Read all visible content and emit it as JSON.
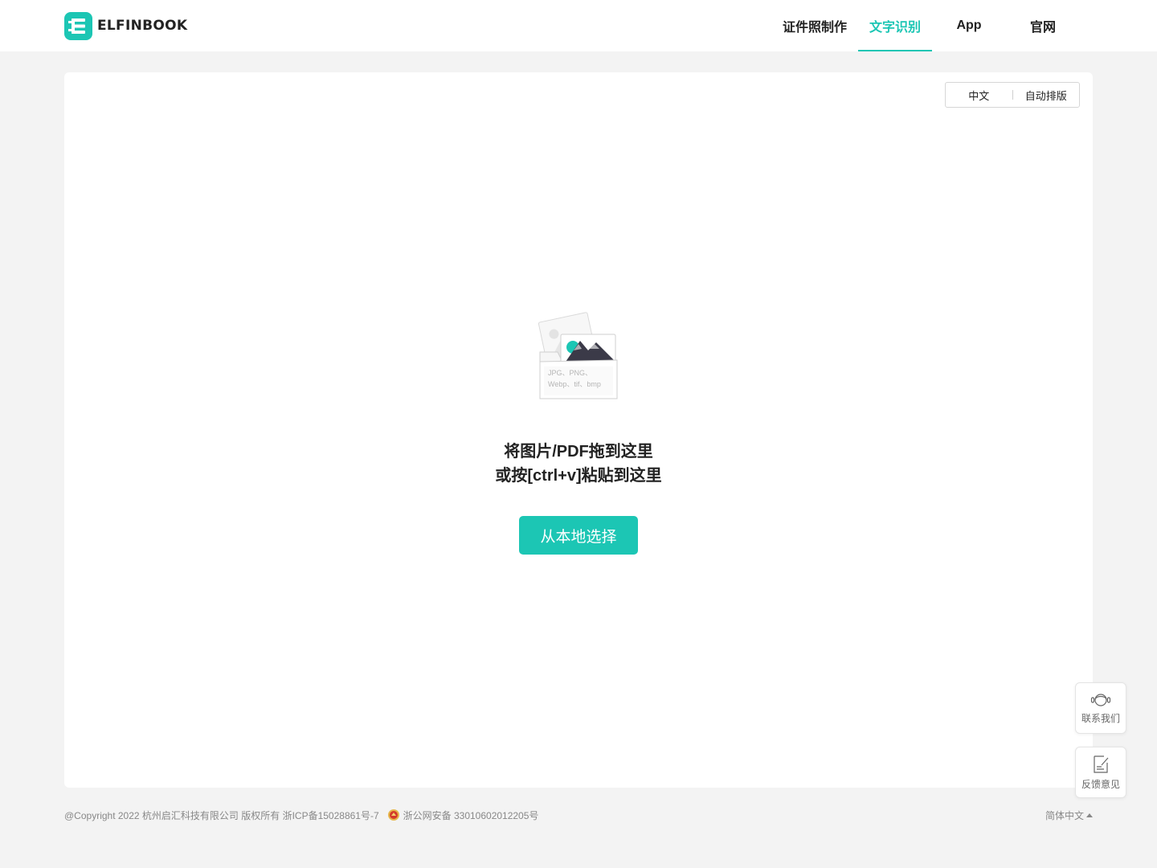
{
  "brand": {
    "name": "ELFINBOOK",
    "color": "#1cc6b4"
  },
  "nav": {
    "items": [
      {
        "label": "证件照制作"
      },
      {
        "label": "文字识别"
      },
      {
        "label": "App"
      },
      {
        "label": "官网"
      }
    ],
    "active_index": 1
  },
  "options": {
    "language": "中文",
    "layout": "自动排版"
  },
  "upload": {
    "formats_line1": "JPG、PNG、",
    "formats_line2": "Webp、tif、bmp",
    "instruction_line1": "将图片/PDF拖到这里",
    "instruction_line2": "或按[ctrl+v]粘贴到这里",
    "choose_button": "从本地选择"
  },
  "float": {
    "contact_label": "联系我们",
    "feedback_label": "反馈意见"
  },
  "footer": {
    "copyright": "@Copyright 2022 杭州启汇科技有限公司 版权所有 浙ICP备15028861号-7",
    "police": "浙公网安备 33010602012205号",
    "language": "简体中文"
  }
}
